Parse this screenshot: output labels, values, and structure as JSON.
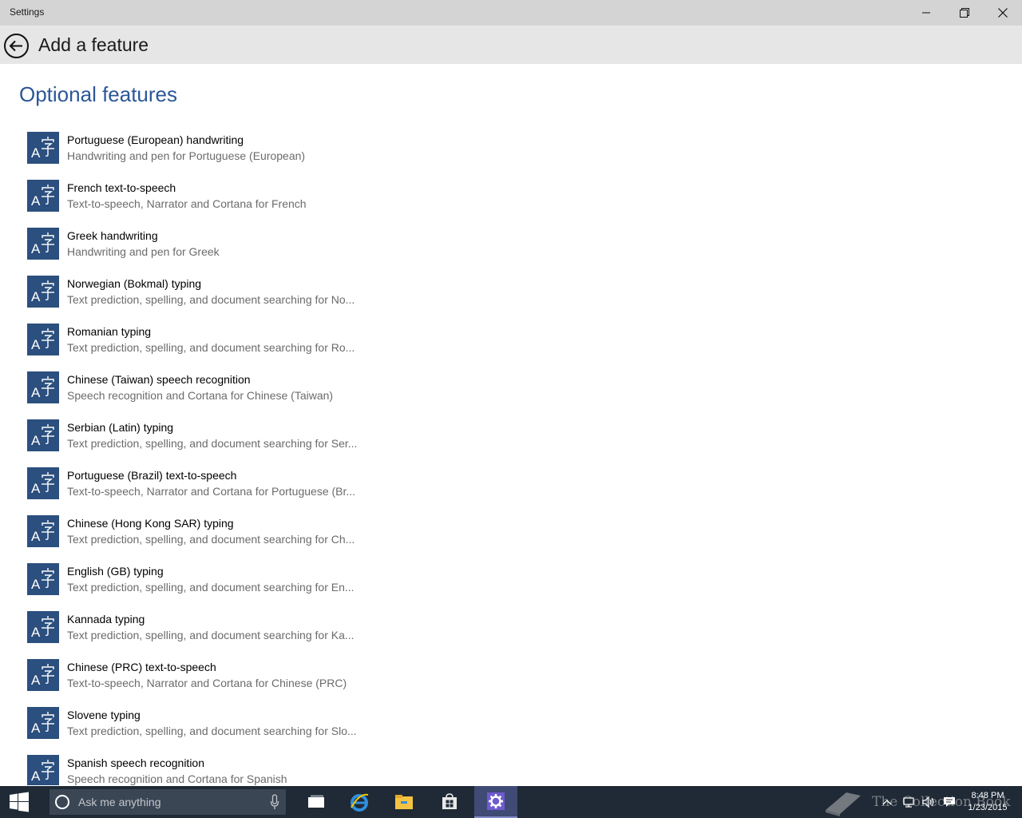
{
  "window": {
    "title": "Settings"
  },
  "header": {
    "page_title": "Add a feature"
  },
  "section": {
    "title": "Optional features"
  },
  "features": [
    {
      "name": "Portuguese (European) handwriting",
      "description": "Handwriting and pen for Portuguese (European)"
    },
    {
      "name": "French text-to-speech",
      "description": "Text-to-speech, Narrator and Cortana for French"
    },
    {
      "name": "Greek handwriting",
      "description": "Handwriting and pen for Greek"
    },
    {
      "name": "Norwegian (Bokmal) typing",
      "description": "Text prediction, spelling, and document searching for No..."
    },
    {
      "name": "Romanian typing",
      "description": "Text prediction, spelling, and document searching for Ro..."
    },
    {
      "name": "Chinese (Taiwan) speech recognition",
      "description": "Speech recognition and Cortana for Chinese (Taiwan)"
    },
    {
      "name": "Serbian (Latin) typing",
      "description": "Text prediction, spelling, and document searching for Ser..."
    },
    {
      "name": "Portuguese (Brazil) text-to-speech",
      "description": "Text-to-speech, Narrator and Cortana for Portuguese (Br..."
    },
    {
      "name": "Chinese (Hong Kong SAR) typing",
      "description": "Text prediction, spelling, and document searching for Ch..."
    },
    {
      "name": "English (GB) typing",
      "description": "Text prediction, spelling, and document searching for En..."
    },
    {
      "name": "Kannada typing",
      "description": "Text prediction, spelling, and document searching for Ka..."
    },
    {
      "name": "Chinese (PRC) text-to-speech",
      "description": "Text-to-speech, Narrator and Cortana for Chinese (PRC)"
    },
    {
      "name": "Slovene typing",
      "description": "Text prediction, spelling, and document searching for Slo..."
    },
    {
      "name": "Spanish speech recognition",
      "description": "Speech recognition and Cortana for Spanish"
    }
  ],
  "feature_icon": "language-icon",
  "colors": {
    "accent": "#2b5797",
    "tile": "#2b4f7e",
    "taskbar": "#1f2a36",
    "active_app": "#3f4a75"
  },
  "taskbar": {
    "search_placeholder": "Ask me anything",
    "apps": [
      "task-view-icon",
      "internet-explorer-icon",
      "file-explorer-icon",
      "store-icon",
      "settings-icon"
    ],
    "active_app": "settings-icon",
    "watermark": "The Collection Book",
    "time": "8:48 PM",
    "date": "1/23/2015"
  }
}
